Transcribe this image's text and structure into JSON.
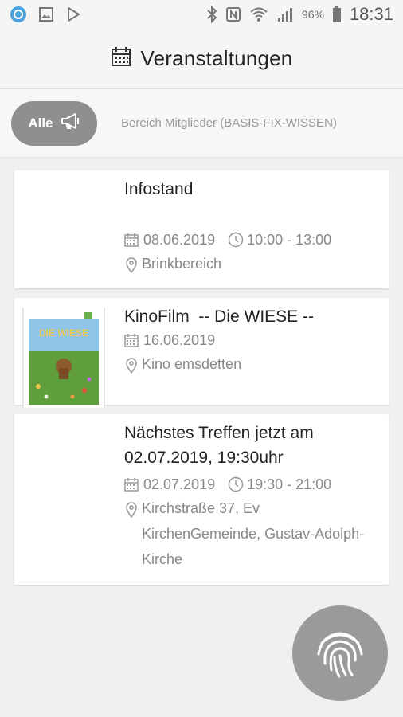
{
  "status_bar": {
    "battery_percent": "96%",
    "time": "18:31"
  },
  "header": {
    "title": "Veranstaltungen",
    "icon": "calendar-icon"
  },
  "filters": {
    "active_label": "Alle",
    "active_icon": "megaphone-icon",
    "other_label": "Bereich Mitglieder (BASIS-FIX-WISSEN)"
  },
  "events": [
    {
      "title": "Infostand",
      "date": "08.06.2019",
      "time": "10:00 - 13:00",
      "location": "Brinkbereich"
    },
    {
      "title": "KinoFilm  -- Die WIESE --",
      "date": "16.06.2019",
      "location": "Kino emsdetten",
      "poster_text": "DIE WIESE"
    },
    {
      "title": "Nächstes Treffen jetzt am 02.07.2019, 19:30uhr",
      "date": "02.07.2019",
      "time": "19:30 - 21:00",
      "location": "Kirchstraße 37, Ev KirchenGemeinde, Gustav-Adolph-Kirche"
    }
  ],
  "fab": {
    "icon": "fingerprint-icon"
  },
  "colors": {
    "chip_active": "#8f8f8f",
    "meta_text": "#888888",
    "fab": "#9a9a9a"
  }
}
